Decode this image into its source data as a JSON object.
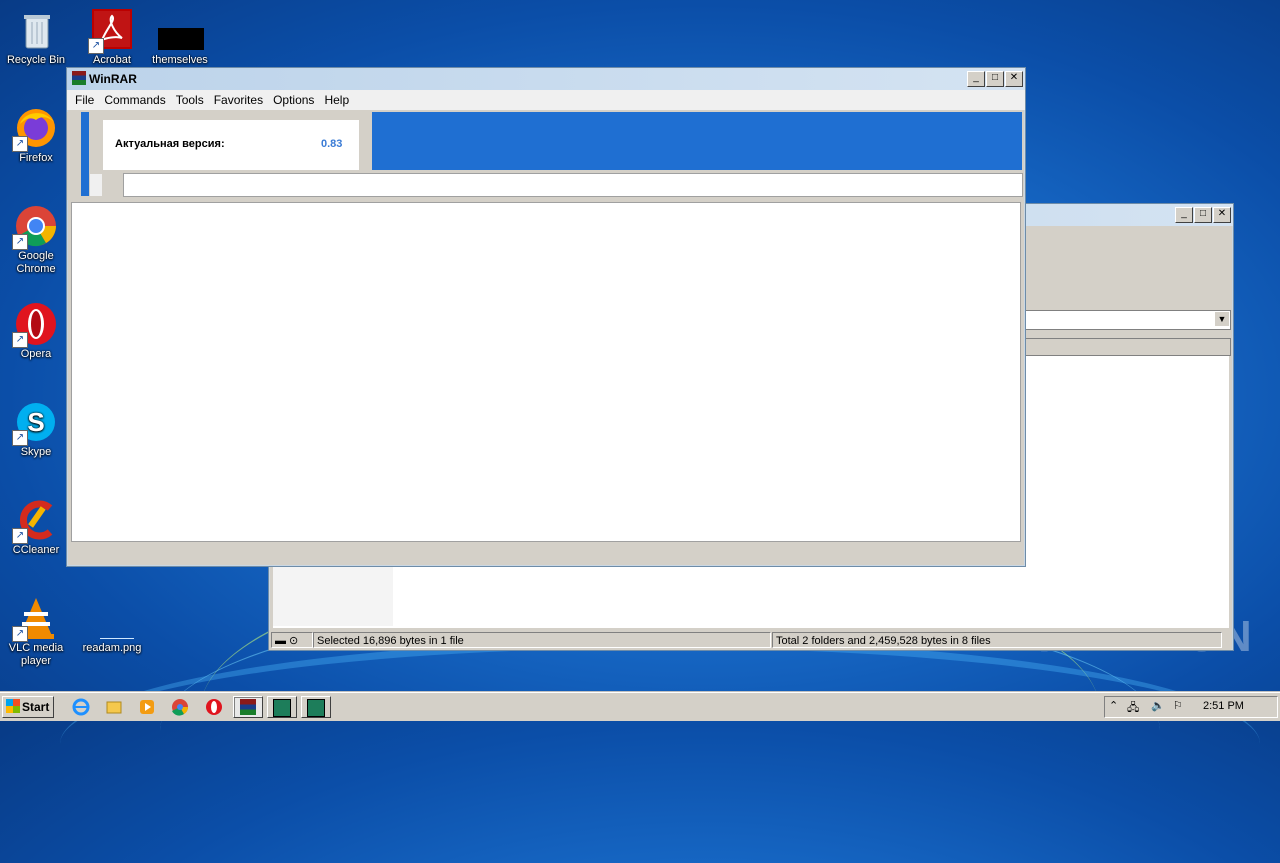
{
  "desktop": {
    "icons": [
      {
        "label": "Recycle Bin"
      },
      {
        "label": "Acrobat"
      },
      {
        "label": "themselves"
      },
      {
        "label": "Firefox"
      },
      {
        "label": "Google Chrome"
      },
      {
        "label": "Opera"
      },
      {
        "label": "Skype"
      },
      {
        "label": "CCleaner"
      },
      {
        "label": "VLC media player"
      },
      {
        "label": "readam.png"
      }
    ],
    "watermark": "ANY RUN"
  },
  "winrar": {
    "title": "WinRAR",
    "menu": [
      "File",
      "Commands",
      "Tools",
      "Favorites",
      "Options",
      "Help"
    ],
    "banner": {
      "label": "Актуальная версия:",
      "value": "0.83"
    },
    "controls": {
      "minimize": "_",
      "maximize": "□",
      "close": "✕"
    }
  },
  "back_window": {
    "status_left": "Selected 16,896 bytes in 1 file",
    "status_right": "Total 2 folders and 2,459,528 bytes in 8 files",
    "dropdown_arrow": "▼"
  },
  "taskbar": {
    "start_label": "Start",
    "clock": "2:51 PM"
  },
  "colors": {
    "accent": "#1f6fd2",
    "version": "#3a7bd5"
  }
}
